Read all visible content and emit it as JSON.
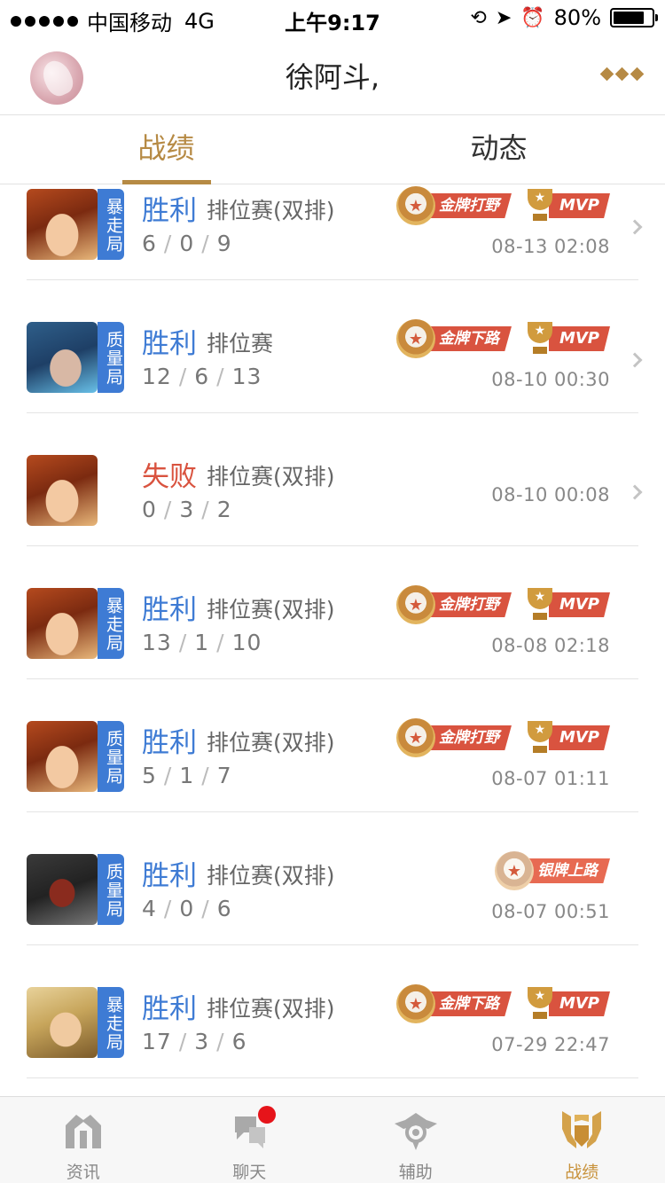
{
  "status_bar": {
    "carrier": "中国移动",
    "network": "4G",
    "time": "上午9:17",
    "battery": "80%",
    "battery_level": 0.8
  },
  "header": {
    "title": "徐阿斗,",
    "avatar": "avatar-image",
    "more_icon": "more-dots-icon"
  },
  "tabs": [
    {
      "label": "战绩",
      "active": true
    },
    {
      "label": "动态",
      "active": false
    }
  ],
  "matches": [
    {
      "hero": "hero-a",
      "tag": "暴走局",
      "result": "胜利",
      "mode": "排位赛(双排)",
      "kda": [
        "6",
        "0",
        "9"
      ],
      "badge": "金牌打野",
      "mvp": "MVP",
      "time": "08-13 02:08"
    },
    {
      "hero": "hero-b",
      "tag": "质量局",
      "result": "胜利",
      "mode": "排位赛",
      "kda": [
        "12",
        "6",
        "13"
      ],
      "badge": "金牌下路",
      "mvp": "MVP",
      "time": "08-10 00:30"
    },
    {
      "hero": "hero-a",
      "tag": "",
      "result": "失败",
      "mode": "排位赛(双排)",
      "kda": [
        "0",
        "3",
        "2"
      ],
      "badge": "",
      "mvp": "",
      "time": "08-10 00:08"
    },
    {
      "hero": "hero-a",
      "tag": "暴走局",
      "result": "胜利",
      "mode": "排位赛(双排)",
      "kda": [
        "13",
        "1",
        "10"
      ],
      "badge": "金牌打野",
      "mvp": "MVP",
      "time": "08-08 02:18"
    },
    {
      "hero": "hero-a",
      "tag": "质量局",
      "result": "胜利",
      "mode": "排位赛(双排)",
      "kda": [
        "5",
        "1",
        "7"
      ],
      "badge": "金牌打野",
      "mvp": "MVP",
      "time": "08-07 01:11"
    },
    {
      "hero": "hero-c",
      "tag": "质量局",
      "result": "胜利",
      "mode": "排位赛(双排)",
      "kda": [
        "4",
        "0",
        "6"
      ],
      "badge": "银牌上路",
      "mvp": "",
      "time": "08-07 00:51"
    },
    {
      "hero": "hero-d",
      "tag": "暴走局",
      "result": "胜利",
      "mode": "排位赛(双排)",
      "kda": [
        "17",
        "3",
        "6"
      ],
      "badge": "金牌下路",
      "mvp": "MVP",
      "time": "07-29 22:47"
    }
  ],
  "tab_bar": [
    {
      "label": "资讯",
      "icon": "news-icon",
      "active": false
    },
    {
      "label": "聊天",
      "icon": "chat-icon",
      "active": false,
      "notification": true
    },
    {
      "label": "辅助",
      "icon": "assist-icon",
      "active": false
    },
    {
      "label": "战绩",
      "icon": "record-icon",
      "active": true
    }
  ],
  "colors": {
    "accent": "#b68a44",
    "win": "#3e7bd4",
    "lose": "#d9533f",
    "tag_bg": "#3e7bd4",
    "ribbon": "#d9533f"
  }
}
